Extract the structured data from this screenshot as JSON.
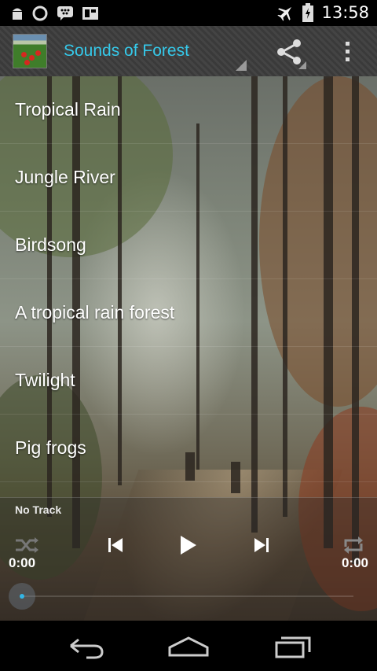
{
  "status_bar": {
    "time": "13:58",
    "icons": [
      "android-robot-icon",
      "circle-icon",
      "bbm-icon",
      "tool-icon",
      "airplane-icon",
      "battery-icon"
    ]
  },
  "action_bar": {
    "title": "Sounds of Forest",
    "icons": [
      "app-icon",
      "share-icon",
      "overflow-menu-icon"
    ],
    "accent_color": "#35c9ea"
  },
  "tracks": [
    {
      "label": "Tropical Rain"
    },
    {
      "label": "Jungle River"
    },
    {
      "label": "Birdsong"
    },
    {
      "label": "A tropical rain forest"
    },
    {
      "label": "Twilight"
    },
    {
      "label": "Pig frogs"
    }
  ],
  "player": {
    "now_playing": "No Track",
    "elapsed": "0:00",
    "duration": "0:00",
    "progress": 0,
    "controls": [
      "shuffle-icon",
      "previous-icon",
      "play-icon",
      "next-icon",
      "repeat-icon"
    ],
    "seek_thumb_color": "#33b5e5"
  },
  "nav_bar": {
    "icons": [
      "back-icon",
      "home-icon",
      "recent-apps-icon"
    ]
  }
}
